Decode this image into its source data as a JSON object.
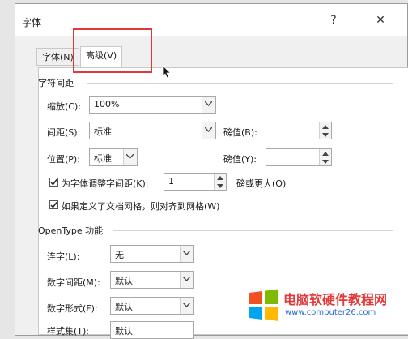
{
  "window": {
    "title": "字体",
    "help_glyph": "?",
    "close_glyph": "✕"
  },
  "tabs": [
    {
      "label": "字体(N)",
      "active": false
    },
    {
      "label": "高级(V)",
      "active": true
    }
  ],
  "char_spacing": {
    "section_title": "字符间距",
    "scale_label": "缩放(C):",
    "scale_value": "100%",
    "spacing_label": "间距(S):",
    "spacing_value": "标准",
    "spacing_by_label": "磅值(B):",
    "spacing_by_value": "",
    "position_label": "位置(P):",
    "position_value": "标准",
    "position_by_label": "磅值(Y):",
    "position_by_value": "",
    "kerning_label": "为字体调整字间距(K):",
    "kerning_value": "1",
    "kerning_suffix": "磅或更大(O)",
    "grid_label": "如果定义了文档网格，则对齐到网格(W)"
  },
  "opentype": {
    "section_title": "OpenType 功能",
    "ligatures_label": "连字(L):",
    "ligatures_value": "无",
    "num_spacing_label": "数字间距(M):",
    "num_spacing_value": "默认",
    "num_form_label": "数字形式(F):",
    "num_form_value": "默认",
    "stylistic_label": "样式集(T):",
    "stylistic_value": "默认"
  },
  "watermark": {
    "text": "电脑软硬件教程网",
    "url": "www.computer26.com",
    "logo_colors": [
      "#f25022",
      "#7fba00",
      "#00a4ef",
      "#ffb900"
    ]
  },
  "colors": {
    "highlight": "#e0393b"
  }
}
